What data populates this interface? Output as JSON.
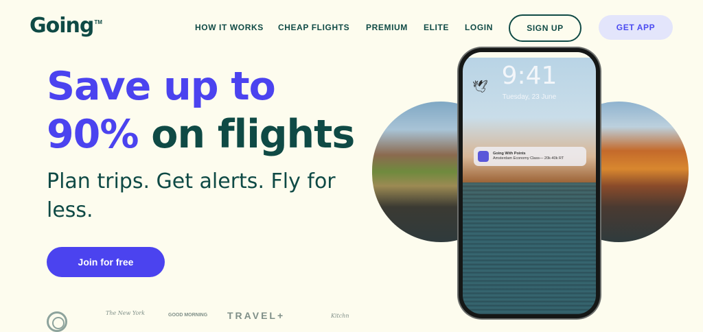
{
  "brand": {
    "name": "Going",
    "tm": "TM"
  },
  "nav": {
    "how_it_works": "HOW IT WORKS",
    "cheap_flights": "CHEAP FLIGHTS",
    "premium": "PREMIUM",
    "elite": "ELITE",
    "login": "LOGIN",
    "sign_up": "SIGN UP",
    "get_app": "GET APP"
  },
  "hero": {
    "headline_line1": "Save up to",
    "headline_pct": "90%",
    "headline_rest": "on flights",
    "subhead": "Plan trips. Get alerts. Fly for less.",
    "cta": "Join for free"
  },
  "phone": {
    "time": "9:41",
    "date": "Tuesday, 23 June",
    "notification": {
      "title": "Going With Points",
      "body": "Amsterdam Economy Class— 20k-40k RT"
    }
  },
  "press": {
    "nyt": "The New York",
    "gma": "GOOD MORNING",
    "travel": "TRAVEL+",
    "kitchn": "Kitchn"
  },
  "colors": {
    "primary": "#4b43ef",
    "dark_green": "#0f4a45",
    "background": "#fdfcee",
    "get_app_bg": "#e3e5fb"
  }
}
